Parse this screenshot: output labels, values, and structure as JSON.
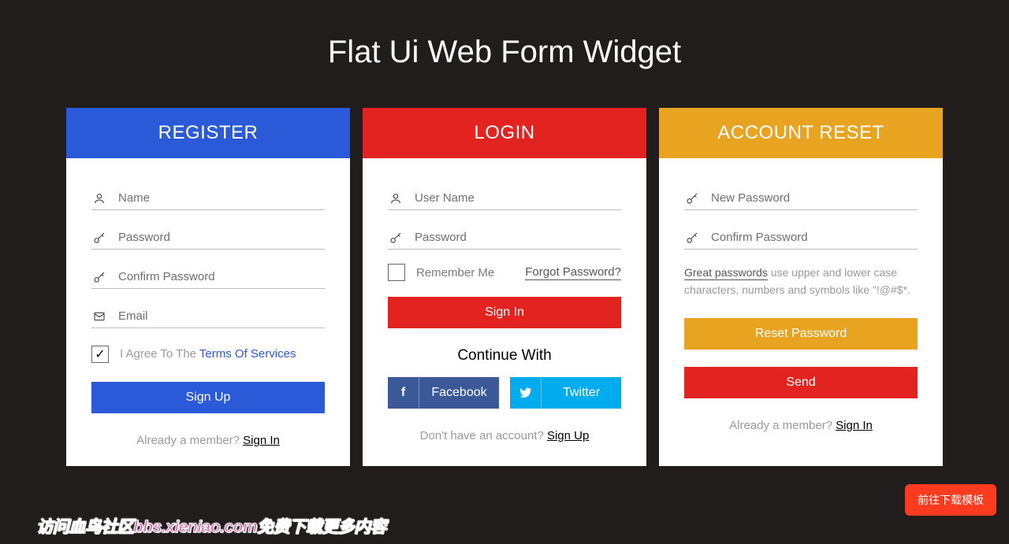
{
  "page_title": "Flat Ui Web Form Widget",
  "register": {
    "header": "REGISTER",
    "name_placeholder": "Name",
    "password_placeholder": "Password",
    "confirm_placeholder": "Confirm Password",
    "email_placeholder": "Email",
    "agree_prefix": "I Agree To The ",
    "agree_link": "Terms Of Services",
    "submit": "Sign Up",
    "foot_prefix": "Already a member? ",
    "foot_link": "Sign In"
  },
  "login": {
    "header": "LOGIN",
    "username_placeholder": "User Name",
    "password_placeholder": "Password",
    "remember": "Remember Me",
    "forgot": "Forgot Password?",
    "submit": "Sign In",
    "continue": "Continue With",
    "facebook": "Facebook",
    "twitter": "Twitter",
    "foot_prefix": "Don't have an account? ",
    "foot_link": "Sign Up"
  },
  "reset": {
    "header": "ACCOUNT RESET",
    "new_pw_placeholder": "New Password",
    "confirm_pw_placeholder": "Confirm Password",
    "hint_lead": "Great passwords",
    "hint_rest": " use upper and lower case characters, numbers and symbols like \"!@#$*.",
    "reset_btn": "Reset Password",
    "send_btn": "Send",
    "foot_prefix": "Already a member? ",
    "foot_link": "Sign In"
  },
  "floating_button": "前往下载模板",
  "watermark": "访问血鸟社区bbs.xieniao.com免费下载更多内容"
}
